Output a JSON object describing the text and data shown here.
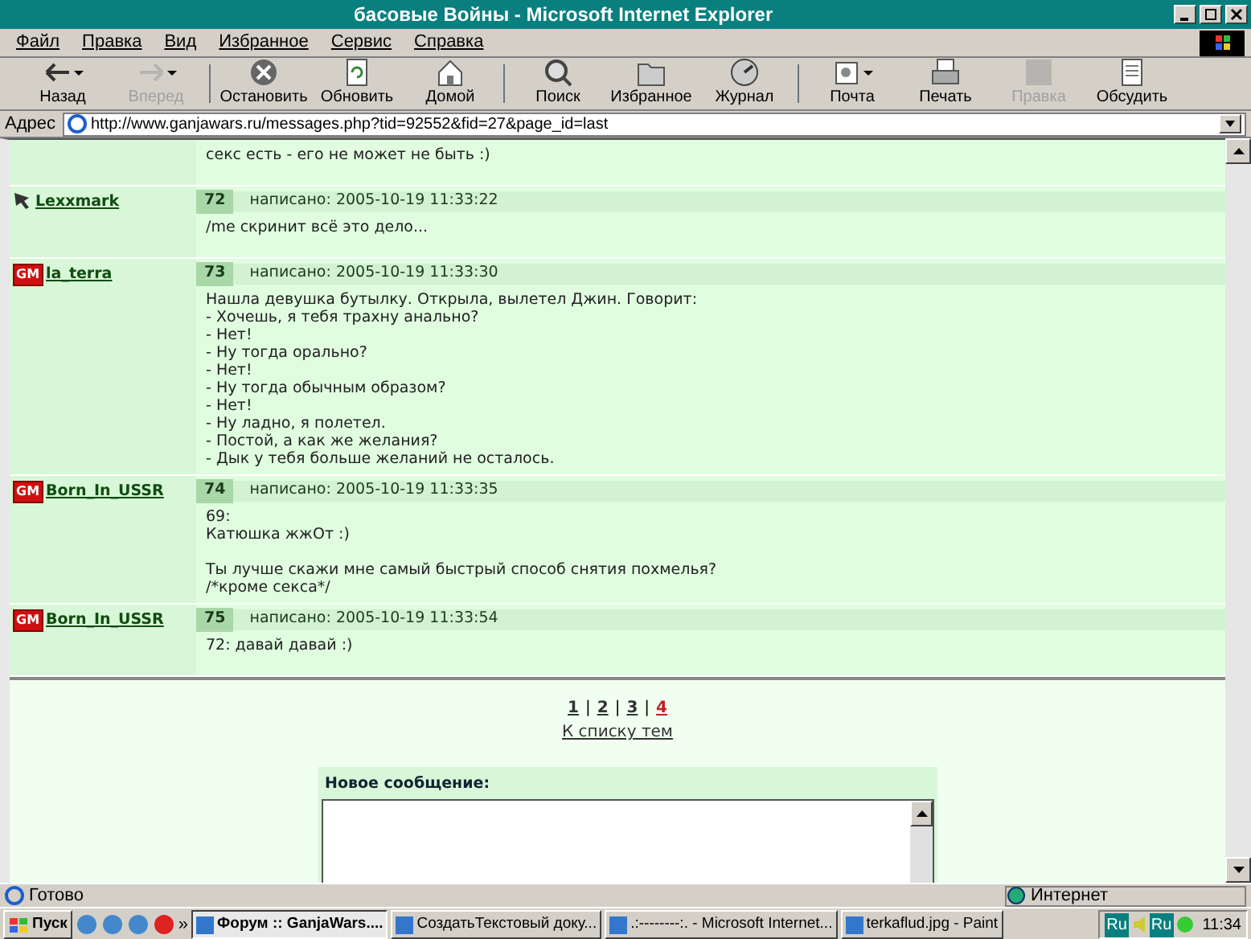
{
  "window": {
    "title": "басовые Войны - Microsoft Internet Explorer"
  },
  "menu": [
    "Файл",
    "Правка",
    "Вид",
    "Избранное",
    "Сервис",
    "Справка"
  ],
  "toolbar": [
    {
      "label": "Назад",
      "disabled": false,
      "dropdown": true
    },
    {
      "label": "Вперед",
      "disabled": true,
      "dropdown": true
    },
    {
      "label": "Остановить",
      "disabled": false,
      "dropdown": false
    },
    {
      "label": "Обновить",
      "disabled": false,
      "dropdown": false
    },
    {
      "label": "Домой",
      "disabled": false,
      "dropdown": false
    },
    {
      "label": "Поиск",
      "disabled": false,
      "dropdown": false
    },
    {
      "label": "Избранное",
      "disabled": false,
      "dropdown": false
    },
    {
      "label": "Журнал",
      "disabled": false,
      "dropdown": false
    },
    {
      "label": "Почта",
      "disabled": false,
      "dropdown": true
    },
    {
      "label": "Печать",
      "disabled": false,
      "dropdown": false
    },
    {
      "label": "Правка",
      "disabled": true,
      "dropdown": false
    },
    {
      "label": "Обсудить",
      "disabled": false,
      "dropdown": false
    }
  ],
  "address": {
    "label": "Адрес",
    "url": "http://www.ganjawars.ru/messages.php?tid=92552&fid=27&page_id=last"
  },
  "posts": [
    {
      "kind": "plain",
      "body": "секс есть - его не может не быть :)"
    },
    {
      "kind": "icon",
      "author": "Lexxmark",
      "number": "72",
      "date": "написано: 2005-10-19 11:33:22",
      "body": "/me скринит всё это дело..."
    },
    {
      "kind": "gm",
      "badge": "GM",
      "author": "la_terra",
      "number": "73",
      "date": "написано: 2005-10-19 11:33:30",
      "body": "Нашла девушка бутылку. Открыла, вылетел Джин. Говорит:\n- Хочешь, я тебя трахну анально?\n- Нет!\n- Ну тогда орально?\n- Нет!\n- Ну тогда обычным образом?\n- Нет!\n- Ну ладно, я полетел.\n- Постой, а как же желания?\n- Дык у тебя больше желаний не осталось."
    },
    {
      "kind": "gm",
      "badge": "GM",
      "author": "Born_In_USSR",
      "number": "74",
      "date": "написано: 2005-10-19 11:33:35",
      "body": "69:\nКатюшка жжОт :)\n\nТы лучше скажи мне самый быстрый способ снятия похмелья?\n/*кроме секса*/"
    },
    {
      "kind": "gm",
      "badge": "GM",
      "author": "Born_In_USSR",
      "number": "75",
      "date": "написано: 2005-10-19 11:33:54",
      "body": "72: давай давай :)"
    }
  ],
  "pagination": {
    "pages": [
      {
        "label": "1",
        "selected": false
      },
      {
        "separator": "|",
        "label": "2",
        "selected": false
      },
      {
        "separator": "|",
        "label": "3",
        "selected": false
      },
      {
        "separator": "|",
        "label": "4",
        "selected": true
      }
    ],
    "back_link": "К списку тем"
  },
  "new_message": {
    "title": "Новое сообщение:"
  },
  "status_bar": {
    "text": "Готово",
    "zone": "Интернет"
  },
  "taskbar": {
    "start": "Пуск",
    "more": "»",
    "tasks": [
      {
        "label": "Форум :: GanjaWars....",
        "selected": true
      },
      {
        "label": "СоздатьТекстовый доку...",
        "selected": false
      },
      {
        "label": ".:--------:. - Microsoft Internet...",
        "selected": false
      },
      {
        "label": "terkaflud.jpg - Paint",
        "selected": false
      }
    ],
    "tray": [
      "Ru",
      "Ru"
    ],
    "clock": "11:34"
  }
}
